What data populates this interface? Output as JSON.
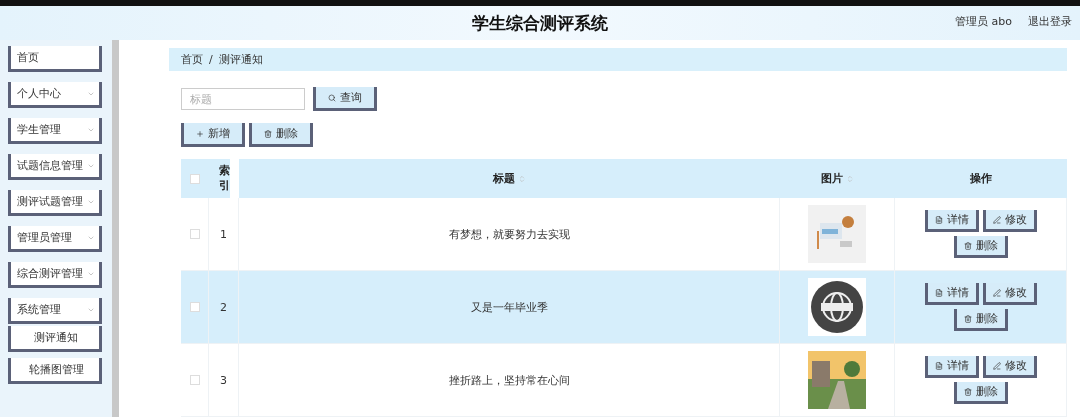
{
  "header": {
    "title": "学生综合测评系统",
    "user": "管理员 abo",
    "logout": "退出登录"
  },
  "sidebar": {
    "items": [
      {
        "label": "首页",
        "kind": "link"
      },
      {
        "label": "个人中心",
        "kind": "menu"
      },
      {
        "label": "学生管理",
        "kind": "menu"
      },
      {
        "label": "试题信息管理",
        "kind": "menu"
      },
      {
        "label": "测评试题管理",
        "kind": "menu"
      },
      {
        "label": "管理员管理",
        "kind": "menu"
      },
      {
        "label": "综合测评管理",
        "kind": "menu"
      },
      {
        "label": "系统管理",
        "kind": "menu",
        "children": [
          {
            "label": "测评通知"
          },
          {
            "label": "轮播图管理"
          }
        ]
      }
    ]
  },
  "breadcrumb": [
    "首页",
    "测评通知"
  ],
  "breadcrumb_separator": "/",
  "search": {
    "placeholder": "标题",
    "button": "查询"
  },
  "actions": [
    {
      "label": "新增",
      "kind": "add"
    },
    {
      "label": "删除",
      "kind": "delete"
    }
  ],
  "table": {
    "all_checked": false,
    "columns": [
      {
        "label": "索引"
      },
      {
        "label": "标题",
        "sortable": true
      },
      {
        "label": "图片",
        "sortable": true
      },
      {
        "label": "操作"
      }
    ],
    "rows": [
      {
        "index": "1",
        "title": "有梦想，就要努力去实现",
        "picture": {
          "kind": "picture"
        },
        "highlighted": false,
        "checked": false,
        "buttons": [
          {
            "label": "详情",
            "kind": "detail"
          },
          {
            "label": "修改",
            "kind": "edit"
          },
          {
            "label": "删除",
            "kind": "delete"
          }
        ]
      },
      {
        "index": "2",
        "title": "又是一年毕业季",
        "picture": {
          "kind": "picture"
        },
        "highlighted": true,
        "checked": false,
        "buttons": [
          {
            "label": "详情",
            "kind": "detail"
          },
          {
            "label": "修改",
            "kind": "edit"
          },
          {
            "label": "删除",
            "kind": "delete"
          }
        ]
      },
      {
        "index": "3",
        "title": "挫折路上，坚持常在心间",
        "picture": {
          "kind": "picture"
        },
        "highlighted": false,
        "checked": false,
        "buttons": [
          {
            "label": "详情",
            "kind": "detail"
          },
          {
            "label": "修改",
            "kind": "edit"
          },
          {
            "label": "删除",
            "kind": "delete"
          }
        ]
      }
    ]
  }
}
